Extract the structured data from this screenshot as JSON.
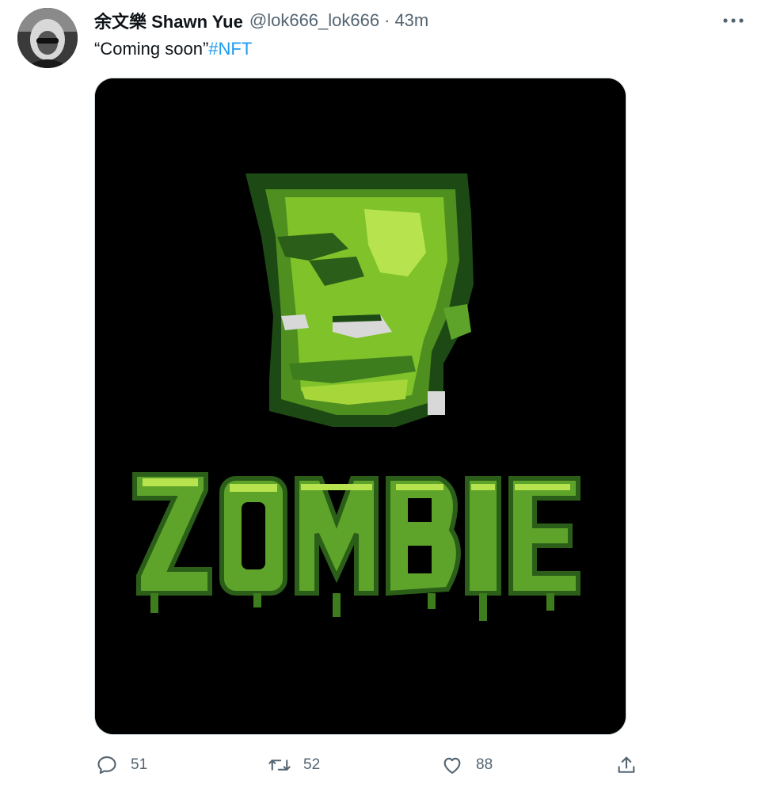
{
  "author": {
    "display_name": "余文樂 Shawn Yue",
    "handle": "@lok666_lok666",
    "separator": "·",
    "time": "43m"
  },
  "tweet": {
    "text": "“Coming soon”",
    "hashtag": "#NFT"
  },
  "media": {
    "image_word": "ZOMBIE",
    "background_color": "#000000",
    "accent_color": "#7fc22a"
  },
  "actions": {
    "reply_count": "51",
    "retweet_count": "52",
    "like_count": "88"
  },
  "icons": {
    "more": "more-horizontal-icon",
    "reply": "reply-icon",
    "retweet": "retweet-icon",
    "like": "heart-icon",
    "share": "share-icon"
  },
  "colors": {
    "link": "#1d9bf0",
    "secondary_text": "#536471",
    "primary_text": "#0f1419"
  }
}
